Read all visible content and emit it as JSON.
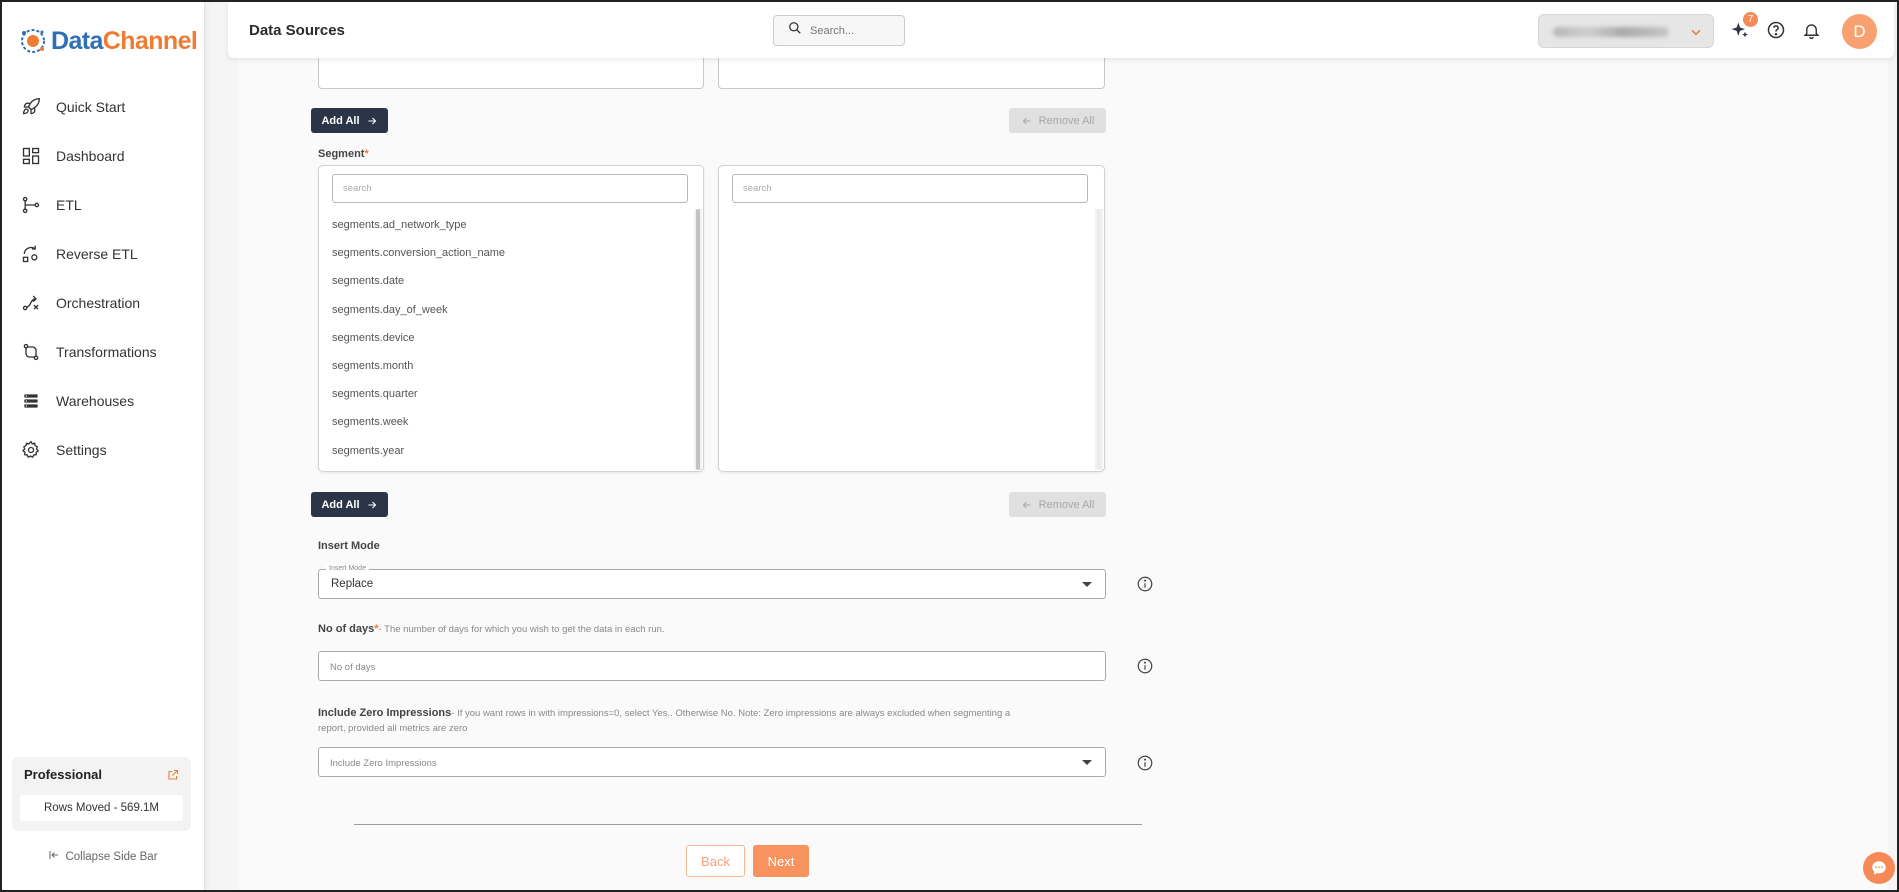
{
  "brand": {
    "name_part1": "Data",
    "name_part2": "Channel"
  },
  "sidebar": {
    "items": [
      {
        "label": "Quick Start",
        "icon": "rocket-icon"
      },
      {
        "label": "Dashboard",
        "icon": "dashboard-icon"
      },
      {
        "label": "ETL",
        "icon": "etl-icon"
      },
      {
        "label": "Reverse ETL",
        "icon": "reverse-etl-icon"
      },
      {
        "label": "Orchestration",
        "icon": "orchestration-icon"
      },
      {
        "label": "Transformations",
        "icon": "transformations-icon"
      },
      {
        "label": "Warehouses",
        "icon": "warehouses-icon"
      },
      {
        "label": "Settings",
        "icon": "gear-icon"
      }
    ],
    "plan": {
      "title": "Professional",
      "rows_moved": "Rows Moved - 569.1M"
    },
    "collapse_label": "Collapse Side Bar"
  },
  "header": {
    "title": "Data Sources",
    "search_placeholder": "Search...",
    "notification_badge": "7",
    "avatar_initial": "D"
  },
  "form": {
    "add_all_label": "Add All",
    "remove_all_label": "Remove All",
    "segment": {
      "label": "Segment",
      "required_mark": "*",
      "search_placeholder": "search",
      "available": [
        "segments.ad_network_type",
        "segments.conversion_action_name",
        "segments.date",
        "segments.day_of_week",
        "segments.device",
        "segments.month",
        "segments.quarter",
        "segments.week",
        "segments.year"
      ]
    },
    "insert_mode": {
      "label": "Insert Mode",
      "floating_label": "Insert Mode",
      "value": "Replace"
    },
    "no_of_days": {
      "label": "No of days",
      "required_mark": "*",
      "hint": "- The number of days for which you wish to get the data in each run.",
      "placeholder": "No of days"
    },
    "zero_impressions": {
      "label": "Include Zero Impressions",
      "hint": "- If you want rows in with impressions=0, select Yes.. Otherwise No. Note: Zero impressions are always excluded when segmenting a report, provided all metrics are zero",
      "placeholder": "Include Zero Impressions"
    },
    "back_label": "Back",
    "next_label": "Next"
  },
  "colors": {
    "accent": "#f8935f",
    "dark_button": "#2a3547",
    "brand_blue": "#2f6fb5",
    "brand_orange": "#f07b33"
  }
}
